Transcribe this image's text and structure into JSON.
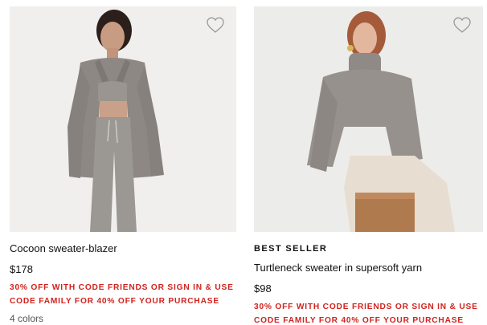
{
  "products": [
    {
      "name": "Cocoon sweater-blazer",
      "badge": "",
      "price": "$178",
      "promo_line1": "30% off with code FRIENDS or sign in & use",
      "promo_line2": "code FAMILY for 40% off your purchase",
      "colors": "4 colors",
      "image_icon": "model-photo"
    },
    {
      "name": "Turtleneck sweater in supersoft yarn",
      "badge": "BEST SELLER",
      "price": "$98",
      "promo_line1": "30% off with code FRIENDS or sign in & use",
      "promo_line2": "code FAMILY for 40% off your purchase",
      "colors": "",
      "image_icon": "model-photo"
    }
  ],
  "icons": {
    "favorite": "heart-outline-icon"
  },
  "colors": {
    "promo_red": "#d0231e",
    "text": "#111111"
  }
}
